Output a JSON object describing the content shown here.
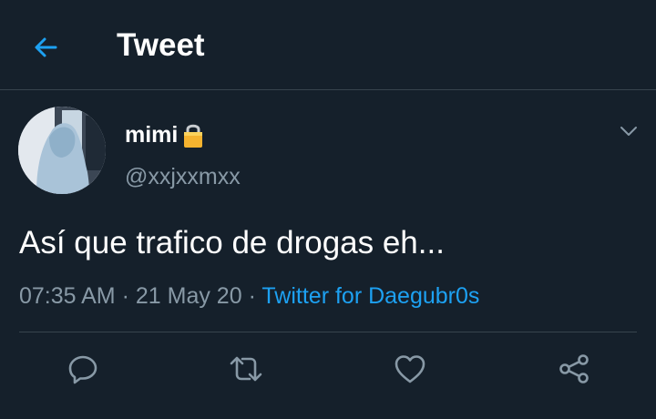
{
  "header": {
    "title": "Tweet",
    "back_icon": "arrow-left-icon"
  },
  "tweet": {
    "user": {
      "name": "mimi",
      "handle": "@xxjxxmxx",
      "protected_icon": "lock-icon"
    },
    "text": "Así que trafico de drogas eh...",
    "time": "07:35 AM",
    "separator": "·",
    "date": "21 May 20",
    "source": "Twitter for Daegubr0s"
  },
  "actions": [
    "reply-icon",
    "retweet-icon",
    "like-icon",
    "share-icon"
  ],
  "colors": {
    "background": "#15202b",
    "accent": "#1da1f2",
    "secondary_text": "#8899a6",
    "divider": "#38444d"
  }
}
